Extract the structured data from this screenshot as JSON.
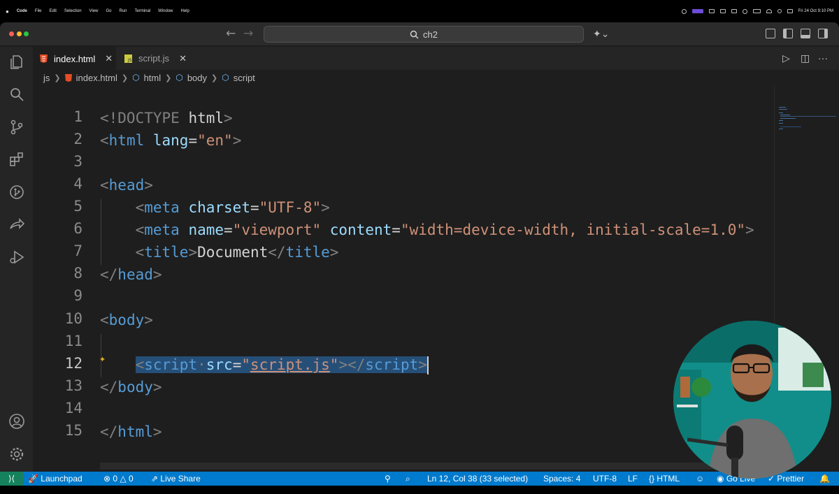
{
  "menubar": {
    "items": [
      "Code",
      "File",
      "Edit",
      "Selection",
      "View",
      "Go",
      "Run",
      "Terminal",
      "Window",
      "Help"
    ],
    "datetime": "Fri 24 Oct  9:10 PM"
  },
  "titlebar": {
    "search_text": "ch2"
  },
  "tabs": [
    {
      "label": "index.html",
      "active": true
    },
    {
      "label": "script.js",
      "active": false
    }
  ],
  "breadcrumb": [
    "js",
    "index.html",
    "html",
    "body",
    "script"
  ],
  "editor": {
    "line_numbers": [
      "1",
      "2",
      "3",
      "4",
      "5",
      "6",
      "7",
      "8",
      "9",
      "10",
      "11",
      "12",
      "13",
      "14",
      "15"
    ],
    "current_line": 12,
    "lines": {
      "l1": {
        "open": "<!DOCTYPE",
        "rest": " html",
        "close": ">"
      },
      "l2": {
        "open": "<",
        "tag": "html",
        "attr": " lang",
        "eq": "=",
        "val": "\"en\"",
        "close": ">"
      },
      "l4": {
        "open": "<",
        "tag": "head",
        "close": ">"
      },
      "l5": {
        "open": "<",
        "tag": "meta",
        "attr": " charset",
        "eq": "=",
        "val": "\"UTF-8\"",
        "close": ">"
      },
      "l6": {
        "open": "<",
        "tag": "meta",
        "attr1": " name",
        "eq1": "=",
        "val1": "\"viewport\"",
        "attr2": " content",
        "eq2": "=",
        "val2": "\"width=device-width, initial-scale=1.0\"",
        "close": ">"
      },
      "l7": {
        "open": "<",
        "tag": "title",
        "mid": ">",
        "text": "Document",
        "open2": "</",
        "tag2": "title",
        "close": ">"
      },
      "l8": {
        "open": "</",
        "tag": "head",
        "close": ">"
      },
      "l10": {
        "open": "<",
        "tag": "body",
        "close": ">"
      },
      "l12": {
        "open": "<",
        "tag": "script",
        "dot": "·",
        "attr": "src",
        "eq": "=",
        "q1": "\"",
        "val": "script.js",
        "q2": "\"",
        "mid": "></",
        "tag2": "script",
        "close": ">"
      },
      "l13": {
        "open": "</",
        "tag": "body",
        "close": ">"
      },
      "l15": {
        "open": "</",
        "tag": "html",
        "close": ">"
      }
    }
  },
  "statusbar": {
    "remote_icon": "remote-icon",
    "launchpad": "Launchpad",
    "errors": "0",
    "warnings": "0",
    "live_share": "Live Share",
    "position": "Ln 12, Col 38 (33 selected)",
    "spaces": "Spaces: 4",
    "encoding": "UTF-8",
    "eol": "LF",
    "language": "HTML",
    "go_live": "Go Live",
    "prettier": "Prettier"
  },
  "colors": {
    "statusbar": "#007acc",
    "remote": "#16825d",
    "selection": "#264f78",
    "tag": "#569cd6",
    "attribute": "#9cdcfe",
    "string": "#ce9178"
  }
}
